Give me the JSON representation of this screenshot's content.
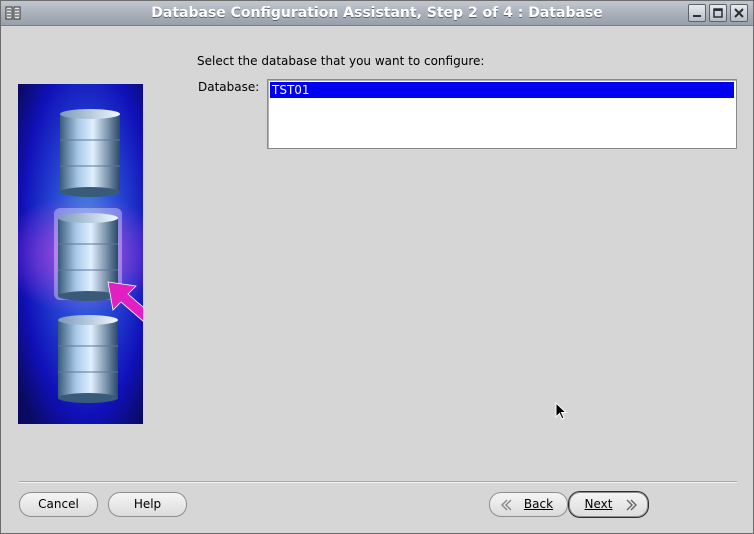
{
  "window": {
    "title": "Database Configuration Assistant, Step 2 of 4 : Database",
    "controls": [
      "minimize-icon",
      "maximize-icon",
      "close-icon"
    ]
  },
  "main": {
    "prompt": "Select the database that you want to configure:",
    "database_label": "Database:",
    "databases": [
      "TST01"
    ],
    "selected_index": 0
  },
  "footer": {
    "cancel_label": "Cancel",
    "help_label": "Help",
    "back_label": "Back",
    "next_label": "Next"
  },
  "colors": {
    "selection": "#0000f0",
    "accent_arrow": "#e020c0",
    "illustration_bg": "#1414c8"
  }
}
